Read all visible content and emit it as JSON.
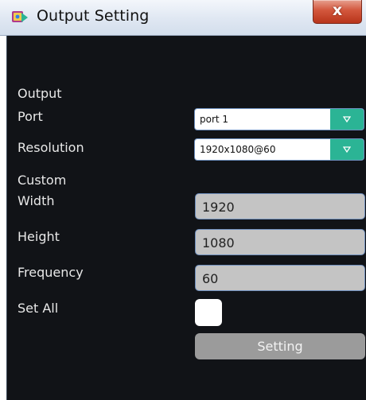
{
  "window": {
    "title": "Output Setting",
    "close_label": "x"
  },
  "output": {
    "section_label": "Output",
    "port_label": "Port",
    "port_value": "port 1",
    "resolution_label": "Resolution",
    "resolution_value": "1920x1080@60"
  },
  "custom": {
    "section_label": "Custom",
    "width_label": "Width",
    "width_value": "1920",
    "height_label": "Height",
    "height_value": "1080",
    "frequency_label": "Frequency",
    "frequency_value": "60",
    "set_all_label": "Set All",
    "set_all_checked": false,
    "setting_button_label": "Setting"
  },
  "colors": {
    "background": "#111317",
    "dropdown_arrow": "#2bb495",
    "field_fill": "#c4c4c4",
    "button_fill": "#9b9b9b",
    "close_button": "#c7472c"
  },
  "icons": {
    "app": "app-logo-icon",
    "close": "close-icon",
    "dropdown": "triangle-down-icon"
  }
}
